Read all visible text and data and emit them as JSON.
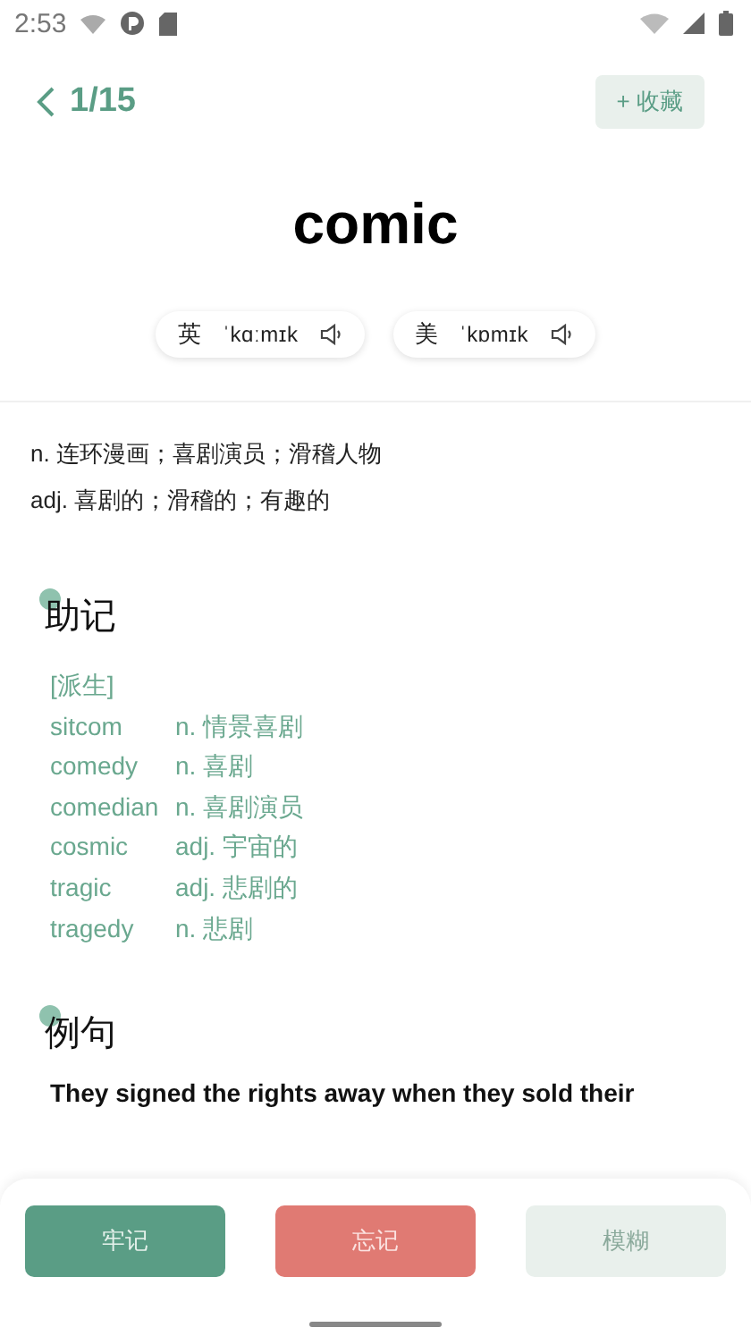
{
  "status_bar": {
    "time": "2:53"
  },
  "header": {
    "counter": "1/15",
    "favorite_button": "+ 收藏"
  },
  "word": "comic",
  "pronunciations": [
    {
      "region": "英",
      "ipa": "ˈkɑːmɪk"
    },
    {
      "region": "美",
      "ipa": "ˈkɒmɪk"
    }
  ],
  "definitions": [
    "n. 连环漫画；喜剧演员；滑稽人物",
    "adj. 喜剧的；滑稽的；有趣的"
  ],
  "mnemonic": {
    "heading": "助记",
    "tag": "[派生]",
    "derivatives": [
      {
        "word": "sitcom",
        "meaning": "n. 情景喜剧"
      },
      {
        "word": "comedy",
        "meaning": "n. 喜剧"
      },
      {
        "word": "comedian",
        "meaning": "n. 喜剧演员"
      },
      {
        "word": "cosmic",
        "meaning": "adj. 宇宙的"
      },
      {
        "word": "tragic",
        "meaning": "adj. 悲剧的"
      },
      {
        "word": "tragedy",
        "meaning": "n. 悲剧"
      }
    ]
  },
  "examples": {
    "heading": "例句",
    "sentences": [
      "They signed the rights away when they sold their"
    ]
  },
  "actions": [
    {
      "label": "牢记",
      "kind": "remember"
    },
    {
      "label": "忘记",
      "kind": "forget"
    },
    {
      "label": "模糊",
      "kind": "vague"
    }
  ]
}
